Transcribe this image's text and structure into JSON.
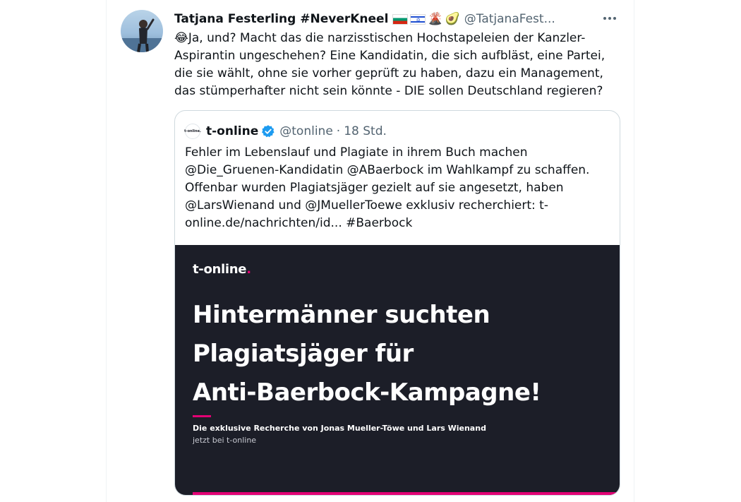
{
  "tweet": {
    "author": {
      "display_name": "Tatjana Festerling #NeverKneel",
      "handle": "@TatjanaFest...",
      "emojis": [
        "bulgaria-flag",
        "israel-flag",
        "volcano",
        "avocado"
      ]
    },
    "emoji_prefix": "😂",
    "text": "Ja, und? Macht das die narzisstischen Hochstapeleien der Kanzler-Aspirantin ungeschehen? Eine Kandidatin, die sich aufbläst, eine Partei, die sie wählt, ohne sie vorher geprüft zu haben, dazu ein Management, das stümperhafter nicht sein könnte - DIE sollen Deutschland regieren?"
  },
  "quote": {
    "avatar_text": "t-online.",
    "name": "t-online",
    "verified": true,
    "handle": "@tonline",
    "separator": "·",
    "time": "18 Std.",
    "text": "Fehler im Lebenslauf und Plagiate in ihrem Buch machen @Die_Gruenen-Kandidatin @ABaerbock im Wahlkampf zu schaffen. Offenbar wurden Plagiatsjäger gezielt auf sie angesetzt, haben @LarsWienand und @JMuellerToewe exklusiv recherchiert: t-online.de/nachrichten/id... #Baerbock",
    "media": {
      "logo_text": "t-online",
      "logo_dot": ".",
      "headline_lines": [
        "Hintermänner suchten",
        "Plagiatsjäger für",
        "Anti-Baerbock-Kampagne!"
      ],
      "subtitle": "Die exklusive Recherche von Jonas Mueller-Töwe und Lars Wienand",
      "cta": "jetzt bei t-online"
    }
  },
  "colors": {
    "text": "#0f1419",
    "secondary": "#536471",
    "verified": "#1d9bf0",
    "media_bg": "#1c1e28",
    "magenta": "#e20074"
  }
}
